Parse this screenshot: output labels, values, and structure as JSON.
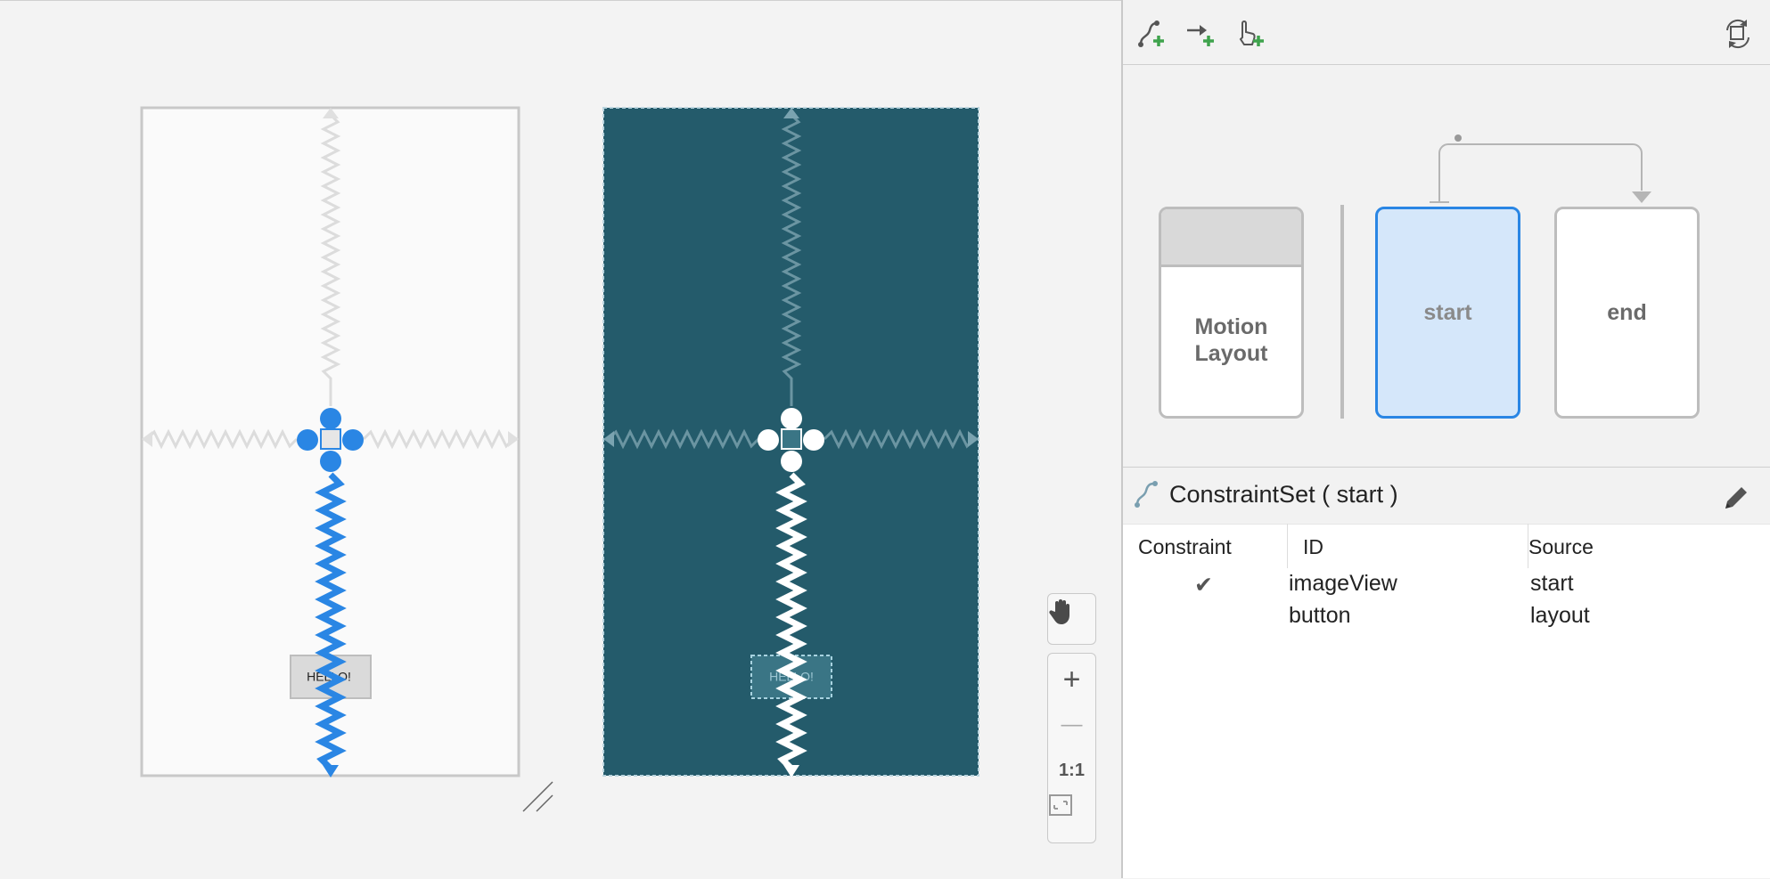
{
  "canvas": {
    "start_button_label": "HELLO!",
    "end_button_label": "HELLO!"
  },
  "zoom_toolbar": {
    "pan_icon": "hand-icon",
    "zoom_in_label": "+",
    "zoom_out_label": "—",
    "actual_size_label": "1:1",
    "fit_icon": "fit-screen-icon"
  },
  "motion_toolbar": {
    "icons": [
      "create-constraintset-icon",
      "create-transition-icon",
      "create-click-handler-icon",
      "cycle-layout-icon"
    ]
  },
  "graph": {
    "states": [
      {
        "label": "Motion\nLayout"
      },
      {
        "label": "start"
      },
      {
        "label": "end"
      }
    ]
  },
  "constraintset": {
    "title": "ConstraintSet ( start )",
    "edit_icon": "pencil-icon"
  },
  "table": {
    "columns": [
      "Constraint",
      "ID",
      "Source"
    ],
    "rows": [
      {
        "constraint": "✔",
        "id": "imageView",
        "source": "start"
      },
      {
        "constraint": "",
        "id": "button",
        "source": "layout"
      }
    ]
  },
  "colors": {
    "accent": "#2a86e4",
    "end_background": "#245b6b",
    "selected_state": "#d5e7fa"
  }
}
